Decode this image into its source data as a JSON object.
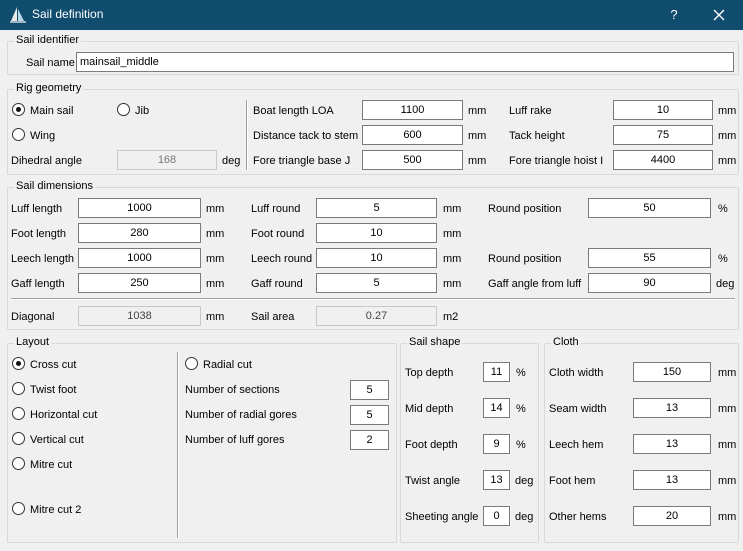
{
  "window": {
    "title": "Sail definition",
    "help_label": "?",
    "icons": {
      "app": "sail-app-icon",
      "close": "close-icon"
    }
  },
  "identifier": {
    "group_title": "Sail identifier",
    "name_label": "Sail name",
    "name_value": "mainsail_middle"
  },
  "rig": {
    "group_title": "Rig geometry",
    "radio_main": "Main sail",
    "radio_jib": "Jib",
    "radio_wing": "Wing",
    "selected": "Main sail",
    "dihedral_label": "Dihedral angle",
    "dihedral_value": "168",
    "dihedral_unit": "deg",
    "boat_length_label": "Boat length LOA",
    "boat_length_value": "1100",
    "boat_length_unit": "mm",
    "tack_stem_label": "Distance tack to stem",
    "tack_stem_value": "600",
    "tack_stem_unit": "mm",
    "fore_base_label": "Fore triangle base  J",
    "fore_base_value": "500",
    "fore_base_unit": "mm",
    "luff_rake_label": "Luff rake",
    "luff_rake_value": "10",
    "luff_rake_unit": "mm",
    "tack_height_label": "Tack height",
    "tack_height_value": "75",
    "tack_height_unit": "mm",
    "fore_hoist_label": "Fore triangle hoist  I",
    "fore_hoist_value": "4400",
    "fore_hoist_unit": "mm"
  },
  "dimensions": {
    "group_title": "Sail dimensions",
    "luff_length_label": "Luff length",
    "luff_length_value": "1000",
    "foot_length_label": "Foot length",
    "foot_length_value": "280",
    "leech_length_label": "Leech length",
    "leech_length_value": "1000",
    "gaff_length_label": "Gaff length",
    "gaff_length_value": "250",
    "luff_round_label": "Luff round",
    "luff_round_value": "5",
    "foot_round_label": "Foot round",
    "foot_round_value": "10",
    "leech_round_label": "Leech round",
    "leech_round_value": "10",
    "gaff_round_label": "Gaff round",
    "gaff_round_value": "5",
    "round_pos1_label": "Round position",
    "round_pos1_value": "50",
    "round_pos2_label": "Round position",
    "round_pos2_value": "55",
    "gaff_angle_label": "Gaff angle from luff",
    "gaff_angle_value": "90",
    "diagonal_label": "Diagonal",
    "diagonal_value": "1038",
    "sail_area_label": "Sail area",
    "sail_area_value": "0.27",
    "unit_mm": "mm",
    "unit_pct": "%",
    "unit_deg": "deg",
    "unit_m2": "m2"
  },
  "layout": {
    "group_title": "Layout",
    "cross_cut": "Cross cut",
    "twist_foot": "Twist foot",
    "horizontal_cut": "Horizontal cut",
    "vertical_cut": "Vertical cut",
    "mitre_cut": "Mitre cut",
    "mitre_cut_2": "Mitre cut 2",
    "radial_cut": "Radial cut",
    "selected": "Cross cut",
    "num_sections_label": "Number of sections",
    "num_sections_value": "5",
    "num_radial_gores_label": "Number of radial gores",
    "num_radial_gores_value": "5",
    "num_luff_gores_label": "Number of luff gores",
    "num_luff_gores_value": "2"
  },
  "shape": {
    "group_title": "Sail shape",
    "top_depth_label": "Top depth",
    "top_depth_value": "11",
    "mid_depth_label": "Mid depth",
    "mid_depth_value": "14",
    "foot_depth_label": "Foot depth",
    "foot_depth_value": "9",
    "twist_angle_label": "Twist angle",
    "twist_angle_value": "13",
    "sheeting_angle_label": "Sheeting angle",
    "sheeting_angle_value": "0"
  },
  "cloth": {
    "group_title": "Cloth",
    "cloth_width_label": "Cloth width",
    "cloth_width_value": "150",
    "seam_width_label": "Seam width",
    "seam_width_value": "13",
    "leech_hem_label": "Leech hem",
    "leech_hem_value": "13",
    "foot_hem_label": "Foot hem",
    "foot_hem_value": "13",
    "other_hems_label": "Other hems",
    "other_hems_value": "20"
  }
}
